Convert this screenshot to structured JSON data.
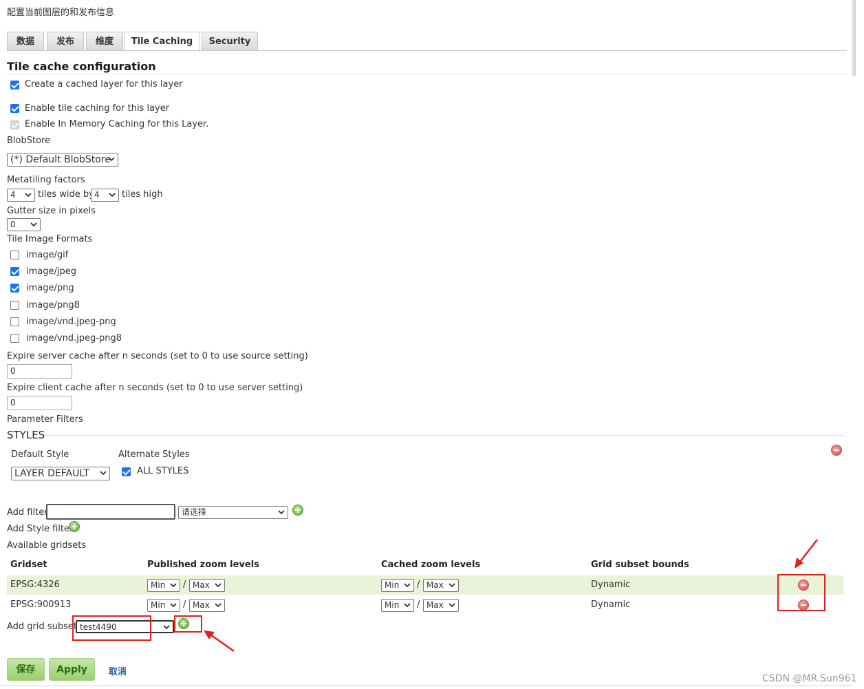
{
  "page": {
    "subtitle": "配置当前图层的和发布信息"
  },
  "tabs": [
    {
      "label": "数据",
      "active": false
    },
    {
      "label": "发布",
      "active": false
    },
    {
      "label": "维度",
      "active": false
    },
    {
      "label": "Tile Caching",
      "active": true
    },
    {
      "label": "Security",
      "active": false
    }
  ],
  "tile_cache": {
    "title": "Tile cache configuration",
    "create_cached_layer": {
      "label": "Create a cached layer for this layer",
      "checked": true
    },
    "enable_tile_caching": {
      "label": "Enable tile caching for this layer",
      "checked": true
    },
    "enable_in_memory": {
      "label": "Enable In Memory Caching for this Layer.",
      "checked": true,
      "disabled": true
    },
    "blobstore_label": "BlobStore",
    "blobstore_value": "(*) Default BlobStore",
    "metatiling_label": "Metatiling factors",
    "metatile_wide": "4",
    "tiles_wide_by": "tiles wide by",
    "metatile_high": "4",
    "tiles_high": "tiles high",
    "gutter_label": "Gutter size in pixels",
    "gutter_value": "0",
    "formats_label": "Tile Image Formats",
    "formats": [
      {
        "label": "image/gif",
        "checked": false
      },
      {
        "label": "image/jpeg",
        "checked": true
      },
      {
        "label": "image/png",
        "checked": true
      },
      {
        "label": "image/png8",
        "checked": false
      },
      {
        "label": "image/vnd.jpeg-png",
        "checked": false
      },
      {
        "label": "image/vnd.jpeg-png8",
        "checked": false
      }
    ],
    "expire_server_label": "Expire server cache after n seconds (set to 0 to use source setting)",
    "expire_server_value": "0",
    "expire_client_label": "Expire client cache after n seconds (set to 0 to use server setting)",
    "expire_client_value": "0",
    "parameter_filters_label": "Parameter Filters"
  },
  "styles": {
    "legend": "STYLES",
    "default_style_label": "Default Style",
    "default_style_value": "LAYER DEFAULT",
    "alternate_styles_label": "Alternate Styles",
    "all_styles": {
      "label": "ALL STYLES",
      "checked": true
    }
  },
  "filters": {
    "add_filter_label": "Add filter",
    "add_filter_input": "",
    "add_filter_select": "请选择",
    "add_style_filter_label": "Add Style filter",
    "available_gridsets_label": "Available gridsets"
  },
  "gridsets": {
    "headers": [
      "Gridset",
      "Published zoom levels",
      "Cached zoom levels",
      "Grid subset bounds"
    ],
    "rows": [
      {
        "name": "EPSG:4326",
        "pub_min": "Min",
        "pub_max": "Max",
        "cache_min": "Min",
        "cache_max": "Max",
        "bounds": "Dynamic"
      },
      {
        "name": "EPSG:900913",
        "pub_min": "Min",
        "pub_max": "Max",
        "cache_min": "Min",
        "cache_max": "Max",
        "bounds": "Dynamic"
      }
    ],
    "separator": "/",
    "add_grid_subset_label": "Add grid subset:",
    "add_grid_subset_value": "test4490"
  },
  "actions": {
    "save": "保存",
    "apply": "Apply",
    "cancel": "取消"
  },
  "watermark": "CSDN @MR.Sun961",
  "colors": {
    "accent_checkbox": "#1a73e8",
    "highlight_row": "#e8f3d8",
    "annotation_red": "#e0201c",
    "button_green": "#9ad06e",
    "link_blue": "#2b5fae"
  }
}
